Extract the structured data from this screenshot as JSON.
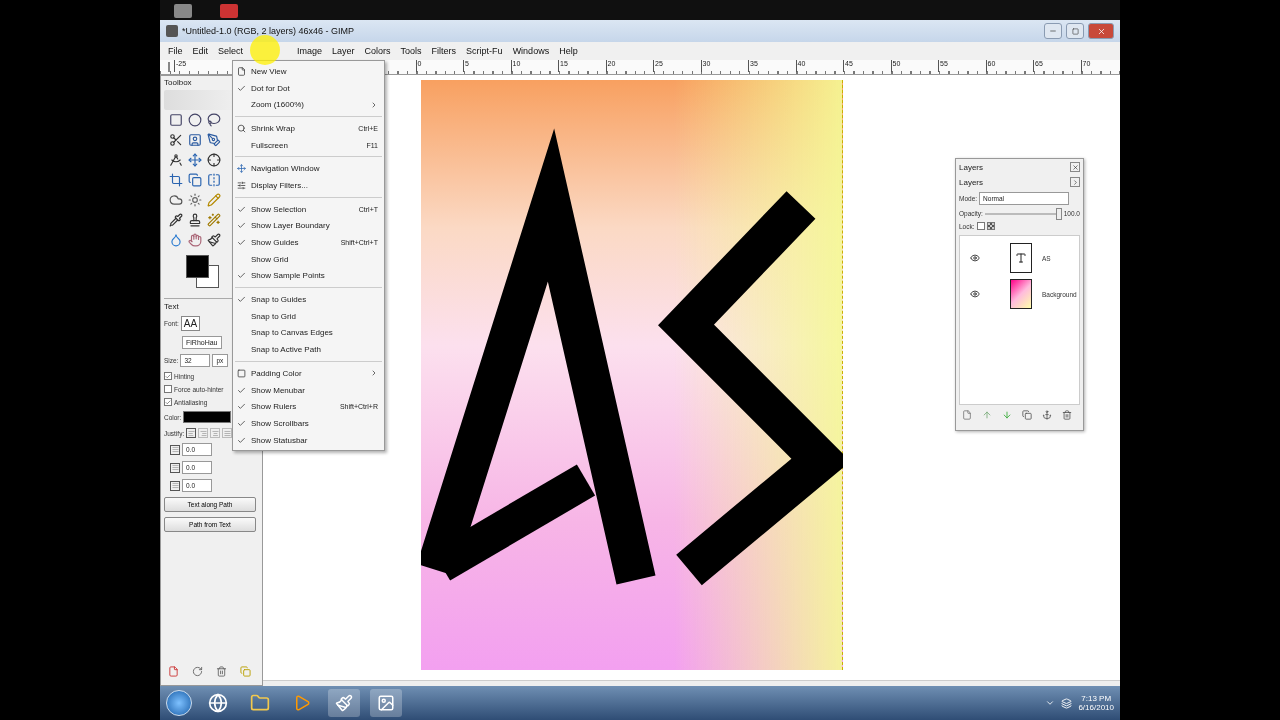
{
  "window": {
    "title": "*Untitled-1.0 (RGB, 2 layers) 46x46 - GIMP",
    "menubar": [
      {
        "label": "File"
      },
      {
        "label": "Edit"
      },
      {
        "label": "Select"
      },
      {
        "label": "Image"
      },
      {
        "label": "Layer"
      },
      {
        "label": "Colors"
      },
      {
        "label": "Tools"
      },
      {
        "label": "Filters"
      },
      {
        "label": "Script-Fu"
      },
      {
        "label": "Windows"
      },
      {
        "label": "Help"
      }
    ]
  },
  "ruler": {
    "start_label": "-25",
    "labels": [
      "0",
      "5",
      "10",
      "15",
      "20",
      "25",
      "30",
      "35",
      "40",
      "45",
      "50",
      "55",
      "60",
      "65",
      "70"
    ]
  },
  "view_menu": {
    "items": [
      {
        "kind": "new-view",
        "label": "New View"
      },
      {
        "kind": "toggle",
        "label": "Dot for Dot",
        "checked": true
      },
      {
        "kind": "submenu",
        "label": "Zoom (1600%)"
      },
      {
        "kind": "separator"
      },
      {
        "kind": "shrink",
        "label": "Shrink Wrap",
        "shortcut": "Ctrl+E"
      },
      {
        "kind": "plain",
        "label": "Fullscreen",
        "shortcut": "F11"
      },
      {
        "kind": "separator"
      },
      {
        "kind": "navigation",
        "label": "Navigation Window"
      },
      {
        "kind": "filters",
        "label": "Display Filters..."
      },
      {
        "kind": "separator"
      },
      {
        "kind": "toggle",
        "label": "Show Selection",
        "checked": true,
        "shortcut": "Ctrl+T"
      },
      {
        "kind": "toggle",
        "label": "Show Layer Boundary",
        "checked": true
      },
      {
        "kind": "toggle",
        "label": "Show Guides",
        "checked": true,
        "shortcut": "Shift+Ctrl+T"
      },
      {
        "kind": "toggle",
        "label": "Show Grid",
        "checked": false
      },
      {
        "kind": "toggle",
        "label": "Show Sample Points",
        "checked": true
      },
      {
        "kind": "separator"
      },
      {
        "kind": "toggle",
        "label": "Snap to Guides",
        "checked": true
      },
      {
        "kind": "toggle",
        "label": "Snap to Grid",
        "checked": false
      },
      {
        "kind": "toggle",
        "label": "Snap to Canvas Edges",
        "checked": false
      },
      {
        "kind": "toggle",
        "label": "Snap to Active Path",
        "checked": false
      },
      {
        "kind": "separator"
      },
      {
        "kind": "padding",
        "label": "Padding Color"
      },
      {
        "kind": "toggle",
        "label": "Show Menubar",
        "checked": true
      },
      {
        "kind": "toggle",
        "label": "Show Rulers",
        "checked": true,
        "shortcut": "Shift+Ctrl+R"
      },
      {
        "kind": "toggle",
        "label": "Show Scrollbars",
        "checked": true
      },
      {
        "kind": "toggle",
        "label": "Show Statusbar",
        "checked": true
      }
    ]
  },
  "toolbox": {
    "title": "Toolbox",
    "tool_options": {
      "title": "Text",
      "font_label": "Font:",
      "font_preview": "AA",
      "font_name": "FiRhoHau",
      "size_label": "Size:",
      "size": "32",
      "unit": "px",
      "options": [
        {
          "label": "Hinting",
          "checked": true
        },
        {
          "label": "Force auto-hinter",
          "checked": false
        },
        {
          "label": "Antialiasing",
          "checked": true
        }
      ],
      "color_label": "Color:",
      "justify_label": "Justify:",
      "spinners": [
        "0.0",
        "0.0",
        "0.0"
      ],
      "buttons": [
        "Text along Path",
        "Path from Text"
      ]
    }
  },
  "layers_dialog": {
    "title": "Layers",
    "tab_label": "Layers",
    "mode_label": "Mode:",
    "mode": "Normal",
    "opacity_label": "Opacity:",
    "opacity": {
      "level": 1,
      "reading": "100.0"
    },
    "lock_label": "Lock:",
    "locks": [
      {
        "kind": "pixels",
        "checked": false
      },
      {
        "kind": "alpha",
        "checked": false
      }
    ],
    "layers": [
      {
        "name": "AS",
        "kind": "text",
        "visible": true
      },
      {
        "name": "Background",
        "kind": "image",
        "visible": true
      }
    ]
  },
  "taskbar": {
    "time": "7:13 PM",
    "date": "6/16/2010"
  }
}
